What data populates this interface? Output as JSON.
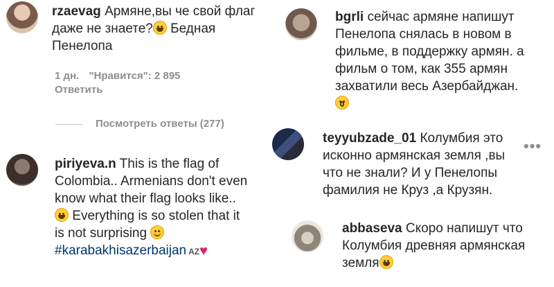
{
  "comments": [
    {
      "username": "rzaevag",
      "lines": [
        "Армяне,вы че свой флаг",
        "даже не знаете?",
        " Бедная",
        "Пенелопа"
      ],
      "time": "1 дн.",
      "likes": "\"Нравится\": 2 895",
      "reply": "Ответить",
      "view_replies": "Посмотреть ответы (277)"
    },
    {
      "username": "bgrli",
      "lines": [
        "сейчас армяне напишут",
        "Пенелопа снялась в новом в",
        "фильме, в поддержку армян. а",
        "фильм о том, как 355 армян",
        "захватили весь Азербайджан."
      ]
    },
    {
      "username": "teyyubzade_01",
      "lines": [
        "Колумбия это",
        "исконно армянская земля ,вы",
        "что не знали? И у Пенелопы",
        "фамилия не Круз ,а Крузян."
      ],
      "more": "•••"
    },
    {
      "username": "piriyeva.n",
      "lines": [
        "This is the flag of",
        "Colombia.. Armenians don't even",
        "know what their flag looks like..",
        "Everything is so stolen that it",
        "is not surprising",
        "#karabakhisazerbaijan",
        "AZ"
      ]
    },
    {
      "username": "abbaseva",
      "lines": [
        "Скоро напишут что",
        "Колумбия древняя армянская",
        "земля"
      ]
    }
  ],
  "icons": {
    "laugh": "laughing-emoji",
    "wink": "wink-emoji",
    "worried": "worried-emoji",
    "heart": "red-heart-emoji",
    "colors": {
      "avatar_bg": "#c9b8a8",
      "meta": "#8e8e8e",
      "hashtag": "#00376b",
      "heart": "#e0245e"
    }
  }
}
